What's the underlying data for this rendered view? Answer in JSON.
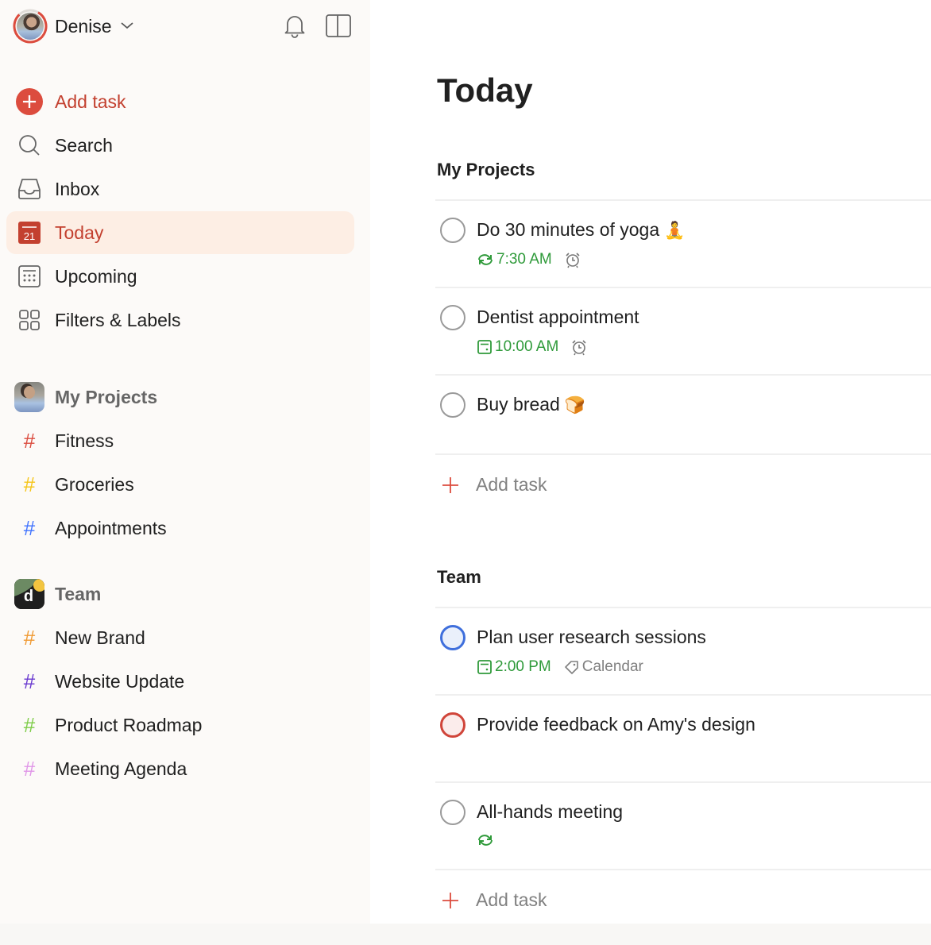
{
  "sidebar": {
    "user": {
      "name": "Denise"
    },
    "header_icons": [
      "bell-icon",
      "sidebar-toggle-icon"
    ],
    "nav": [
      {
        "id": "add-task",
        "label": "Add task",
        "icon": "plus-circle-icon"
      },
      {
        "id": "search",
        "label": "Search",
        "icon": "search-icon"
      },
      {
        "id": "inbox",
        "label": "Inbox",
        "icon": "inbox-icon"
      },
      {
        "id": "today",
        "label": "Today",
        "icon": "calendar-today-icon",
        "day": "21",
        "active": true
      },
      {
        "id": "upcoming",
        "label": "Upcoming",
        "icon": "calendar-grid-icon"
      },
      {
        "id": "filters",
        "label": "Filters & Labels",
        "icon": "filters-grid-icon"
      }
    ],
    "groups": [
      {
        "label": "My Projects",
        "avatar": "user-avatar",
        "projects": [
          {
            "label": "Fitness",
            "color": "#db4c3f"
          },
          {
            "label": "Groceries",
            "color": "#fad000"
          },
          {
            "label": "Appointments",
            "color": "#4073ff"
          }
        ]
      },
      {
        "label": "Team",
        "avatar": "team-logo",
        "avatar_letter": "d",
        "projects": [
          {
            "label": "New Brand",
            "color": "#ff9933"
          },
          {
            "label": "Website Update",
            "color": "#6a3ad0"
          },
          {
            "label": "Product Roadmap",
            "color": "#7ecc49"
          },
          {
            "label": "Meeting Agenda",
            "color": "#e096e8"
          }
        ]
      }
    ]
  },
  "main": {
    "title": "Today",
    "sections": [
      {
        "title": "My Projects",
        "tasks": [
          {
            "title": "Do 30 minutes of yoga",
            "emoji": "🧘",
            "due": "7:30 AM",
            "due_icon": "repeat-icon",
            "reminder": true,
            "priority": "none"
          },
          {
            "title": "Dentist appointment",
            "due": "10:00 AM",
            "due_icon": "calendar-icon",
            "reminder": true,
            "priority": "none"
          },
          {
            "title": "Buy bread",
            "emoji": "🍞",
            "priority": "none"
          }
        ],
        "add_label": "Add task"
      },
      {
        "title": "Team",
        "tasks": [
          {
            "title": "Plan user research sessions",
            "due": "2:00 PM",
            "due_icon": "calendar-icon",
            "label": "Calendar",
            "priority": "p3-blue"
          },
          {
            "title": "Provide feedback on Amy's design",
            "priority": "p1-red"
          },
          {
            "title": "All-hands meeting",
            "due": "",
            "due_icon": "repeat-icon",
            "priority": "none"
          }
        ],
        "add_label": "Add task"
      }
    ]
  },
  "colors": {
    "accent": "#dc4c3e",
    "active_bg": "#fdeee4",
    "due_green": "#2f9a3a",
    "sidebar_bg": "#fcfaf8"
  }
}
